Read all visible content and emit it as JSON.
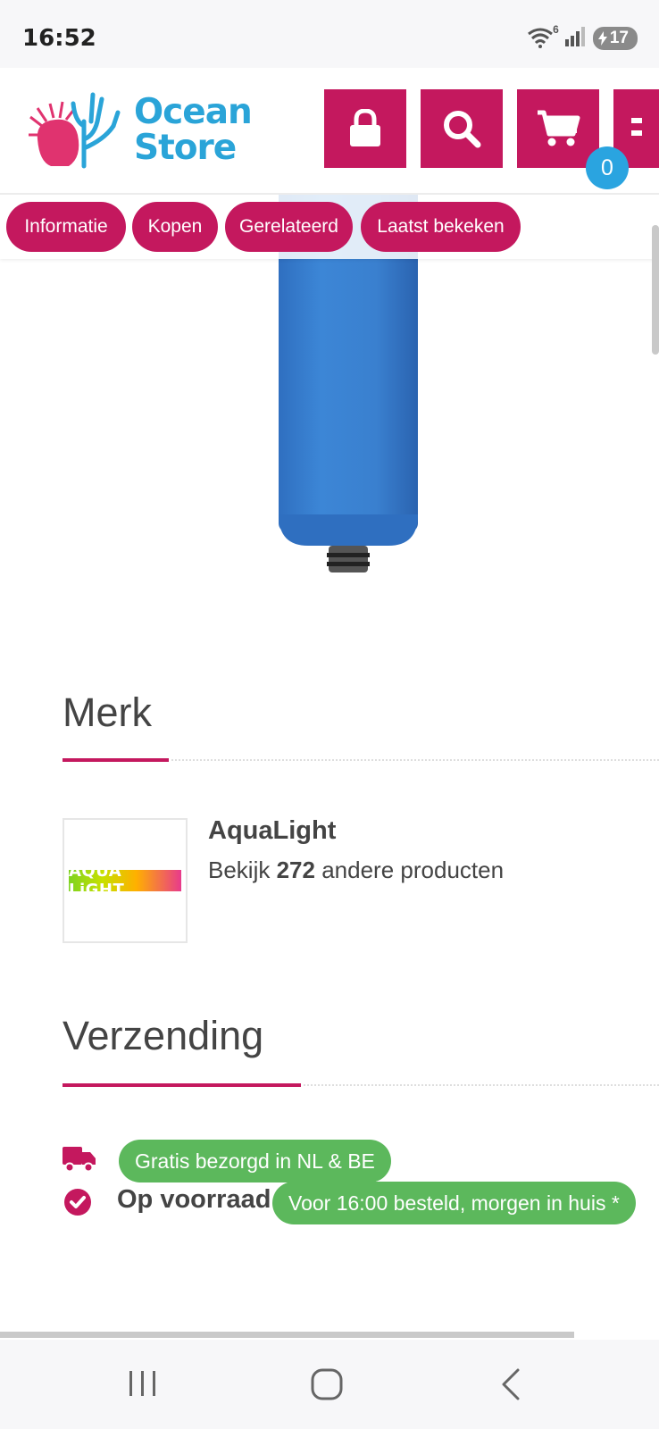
{
  "status_bar": {
    "time": "16:52",
    "wifi_label": "6",
    "battery": "17",
    "icons": [
      "wifi-icon",
      "signal-icon",
      "battery-charging-icon"
    ]
  },
  "header": {
    "logo_line1": "Ocean",
    "logo_line2": "Store",
    "cart_count": "0",
    "buttons": [
      "lock-icon",
      "search-icon",
      "cart-icon",
      "menu-icon"
    ]
  },
  "tabs": [
    {
      "label": "Informatie"
    },
    {
      "label": "Kopen"
    },
    {
      "label": "Gerelateerd"
    },
    {
      "label": "Laatst bekeken"
    }
  ],
  "brand_section": {
    "title": "Merk",
    "brand_name": "AquaLight",
    "logo_text": "AQUA LiGHT",
    "link_prefix": "Bekijk",
    "count": "272",
    "link_suffix": "andere producten"
  },
  "shipping_section": {
    "title": "Verzending",
    "free_delivery": "Gratis bezorgd in NL & BE",
    "stock_status": "Op voorraad",
    "delivery_promise": "Voor 16:00 besteld, morgen in huis *"
  },
  "colors": {
    "brand_primary": "#c4185e",
    "brand_secondary": "#2aa4d8",
    "success": "#5cb85c"
  }
}
